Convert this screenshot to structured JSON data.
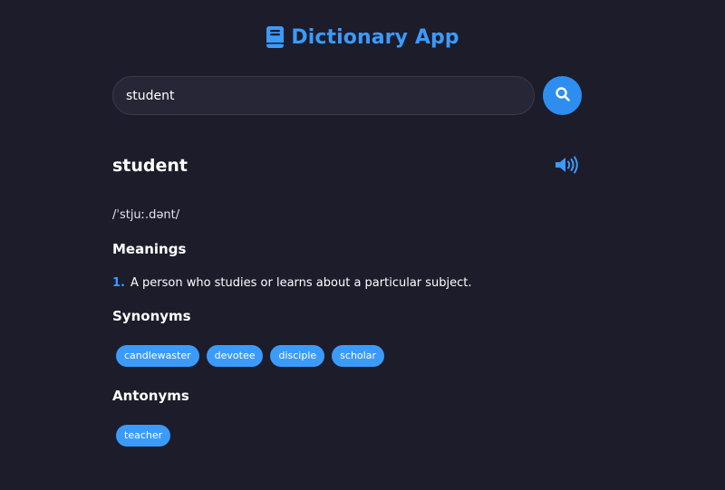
{
  "header": {
    "title": "Dictionary App",
    "icon": "book-icon",
    "accent_color": "#3b9bfb"
  },
  "search": {
    "value": "student",
    "button_icon": "search-icon"
  },
  "result": {
    "word": "student",
    "audio_icon": "speaker-icon",
    "phonetic": "/ˈstjuː.dənt/",
    "meanings_heading": "Meanings",
    "meanings": [
      {
        "number": "1.",
        "text": "A person who studies or learns about a particular subject."
      }
    ],
    "synonyms_heading": "Synonyms",
    "synonyms": [
      "candlewaster",
      "devotee",
      "disciple",
      "scholar"
    ],
    "antonyms_heading": "Antonyms",
    "antonyms": [
      "teacher"
    ]
  }
}
